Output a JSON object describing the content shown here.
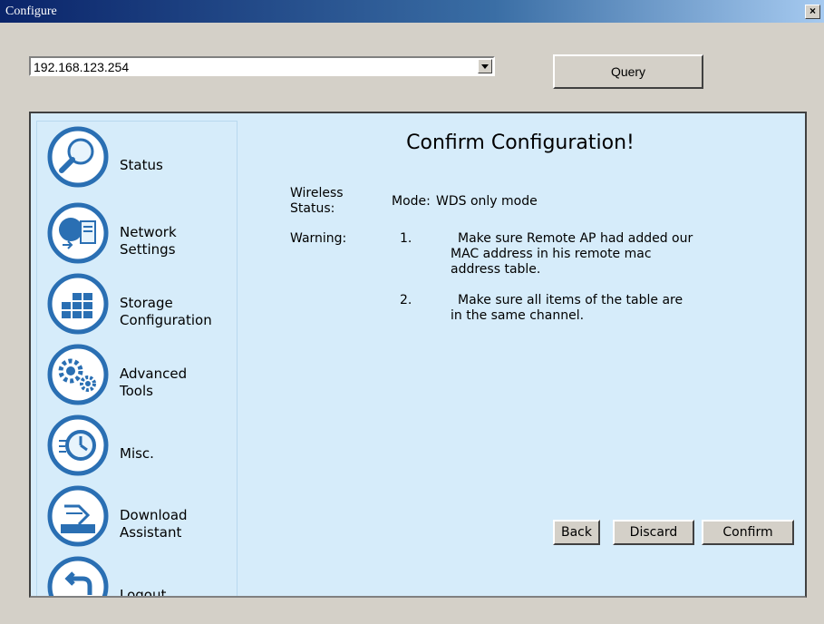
{
  "window": {
    "title": "Configure",
    "close_glyph": "×"
  },
  "address": {
    "value": "192.168.123.254"
  },
  "toolbar": {
    "query_label": "Query"
  },
  "sidebar": {
    "items": [
      {
        "label_line1": "Status",
        "label_line2": "",
        "icon": "magnifier-icon"
      },
      {
        "label_line1": "Network",
        "label_line2": "Settings",
        "icon": "network-icon"
      },
      {
        "label_line1": "Storage",
        "label_line2": "Configuration",
        "icon": "storage-grid-icon"
      },
      {
        "label_line1": "Advanced",
        "label_line2": "Tools",
        "icon": "gears-icon"
      },
      {
        "label_line1": "Misc.",
        "label_line2": "",
        "icon": "clock-icon"
      },
      {
        "label_line1": "Download",
        "label_line2": "Assistant",
        "icon": "download-tray-icon"
      },
      {
        "label_line1": "Logout",
        "label_line2": "",
        "icon": "back-arrow-icon"
      }
    ]
  },
  "main": {
    "heading": "Confirm Configuration!",
    "wireless_label_line1": "Wireless",
    "wireless_label_line2": "Status:",
    "mode_label": "Mode:",
    "mode_value": "WDS only mode",
    "warning_label": "Warning:",
    "warnings": [
      {
        "num": "1.",
        "line1": "Make sure Remote AP had added our",
        "line2": "MAC address in his remote mac",
        "line3": "address table."
      },
      {
        "num": "2.",
        "line1": "Make sure all items of the table are",
        "line2": "in the same channel.",
        "line3": ""
      }
    ],
    "buttons": {
      "back": "Back",
      "discard": "Discard",
      "confirm": "Confirm"
    }
  },
  "colors": {
    "panel_bg": "#d6ecfa",
    "icon_blue": "#2a6fb3",
    "window_gray": "#d4d0c8"
  }
}
